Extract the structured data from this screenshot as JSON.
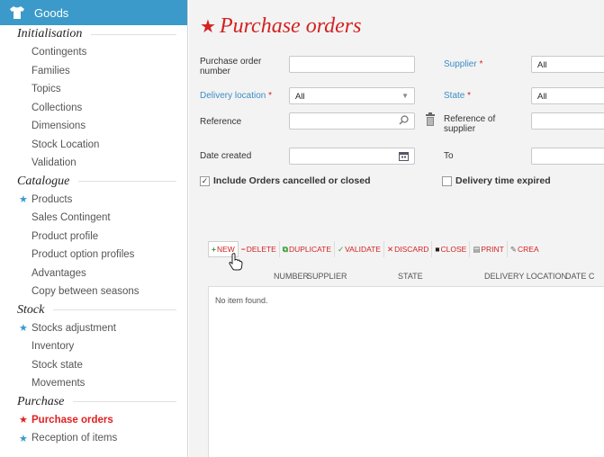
{
  "sidebar": {
    "header": "Goods",
    "sections": [
      {
        "title": "Initialisation",
        "items": [
          {
            "label": "Contingents",
            "starred": false
          },
          {
            "label": "Families",
            "starred": false
          },
          {
            "label": "Topics",
            "starred": false
          },
          {
            "label": "Collections",
            "starred": false
          },
          {
            "label": "Dimensions",
            "starred": false
          },
          {
            "label": "Stock Location",
            "starred": false
          },
          {
            "label": "Validation",
            "starred": false
          }
        ]
      },
      {
        "title": "Catalogue",
        "items": [
          {
            "label": "Products",
            "starred": true
          },
          {
            "label": "Sales Contingent",
            "starred": false
          },
          {
            "label": "Product profile",
            "starred": false
          },
          {
            "label": "Product option profiles",
            "starred": false
          },
          {
            "label": "Advantages",
            "starred": false
          },
          {
            "label": "Copy between seasons",
            "starred": false
          }
        ]
      },
      {
        "title": "Stock",
        "items": [
          {
            "label": "Stocks adjustment",
            "starred": true
          },
          {
            "label": "Inventory",
            "starred": false
          },
          {
            "label": "Stock state",
            "starred": false
          },
          {
            "label": "Movements",
            "starred": false
          }
        ]
      },
      {
        "title": "Purchase",
        "items": [
          {
            "label": "Purchase orders",
            "starred": true,
            "active": true
          },
          {
            "label": "Reception of items",
            "starred": true
          }
        ]
      }
    ]
  },
  "main": {
    "title": "Purchase orders",
    "filters": {
      "po_number_label": "Purchase order number",
      "supplier_label": "Supplier",
      "supplier_value": "All",
      "delivery_location_label": "Delivery location",
      "delivery_location_value": "All",
      "state_label": "State",
      "state_value": "All",
      "reference_label": "Reference",
      "ref_supplier_label": "Reference of supplier",
      "date_created_label": "Date created",
      "to_label": "To",
      "include_cancelled_label": "Include Orders cancelled or closed",
      "include_cancelled_checked": true,
      "delivery_expired_label": "Delivery time expired",
      "delivery_expired_checked": false
    },
    "toolbar": {
      "new": "NEW",
      "delete": "DELETE",
      "duplicate": "DUPLICATE",
      "validate": "VALIDATE",
      "discard": "DISCARD",
      "close": "CLOSE",
      "print": "PRINT",
      "create": "CREA"
    },
    "table": {
      "columns": [
        "NUMBER",
        "SUPPLIER",
        "STATE",
        "DELIVERY LOCATION",
        "DATE C"
      ],
      "empty_message": "No item found."
    }
  },
  "colors": {
    "accent": "#3b9ac9",
    "title_red": "#d32222",
    "required_red": "#d32222",
    "link_blue": "#3b8ec4"
  }
}
